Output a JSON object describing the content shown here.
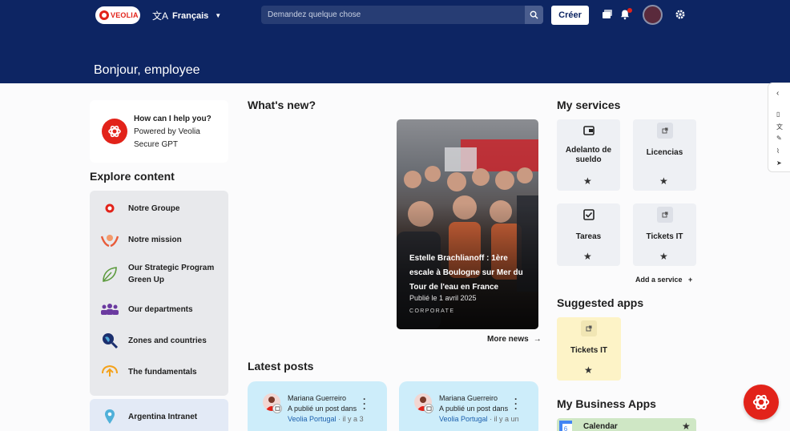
{
  "header": {
    "logo_text": "VEOLIA",
    "language": "Français",
    "search_placeholder": "Demandez quelque chose",
    "create_label": "Créer",
    "greeting": "Bonjour, employee"
  },
  "chat": {
    "title": "How can I help you?",
    "subtitle": "Powered by Veolia Secure GPT"
  },
  "explore": {
    "title": "Explore content",
    "items": [
      {
        "label": "Notre Groupe",
        "icon": "veolia-logo-icon"
      },
      {
        "label": "Notre mission",
        "icon": "hands-icon"
      },
      {
        "label": "Our Strategic Program Green Up",
        "icon": "leaf-icon"
      },
      {
        "label": "Our departments",
        "icon": "people-icon"
      },
      {
        "label": "Zones and countries",
        "icon": "globe-search-icon"
      },
      {
        "label": "The fundamentals",
        "icon": "hand-upload-icon"
      }
    ],
    "intranet_label": "Argentina Intranet"
  },
  "whats_new": {
    "title": "What's new?",
    "card": {
      "title": "Estelle Brachlianoff : 1ère escale à Boulogne sur Mer du Tour de l'eau en France",
      "date": "Publié le 1 avril 2025",
      "category": "CORPORATE"
    },
    "more_label": "More news"
  },
  "latest_posts": {
    "title": "Latest posts",
    "posts": [
      {
        "author": "Mariana Guerreiro",
        "action": "A publié un post dans",
        "group": "Veolia Portugal",
        "time": "· il y a 3"
      },
      {
        "author": "Mariana Guerreiro",
        "action": "A publié un post dans",
        "group": "Veolia Portugal",
        "time": "· il y a un"
      }
    ]
  },
  "services": {
    "title": "My services",
    "items": [
      {
        "label": "Adelanto de sueldo",
        "icon": "wallet-icon"
      },
      {
        "label": "Licencias",
        "icon": "external-link-icon"
      },
      {
        "label": "Tareas",
        "icon": "checkbox-icon"
      },
      {
        "label": "Tickets IT",
        "icon": "external-link-icon"
      }
    ],
    "add_label": "Add a service"
  },
  "suggested": {
    "title": "Suggested apps",
    "items": [
      {
        "label": "Tickets IT",
        "icon": "external-link-icon"
      }
    ]
  },
  "business_apps": {
    "title": "My Business Apps",
    "items": [
      {
        "label": "Calendar",
        "icon": "calendar-icon"
      }
    ]
  },
  "colors": {
    "header_bg": "#0d2563",
    "brand_red": "#e2231a",
    "post_bg": "#cdedfa",
    "suggested_bg": "#fdf3c7",
    "calendar_bg": "#cfe7c5"
  }
}
